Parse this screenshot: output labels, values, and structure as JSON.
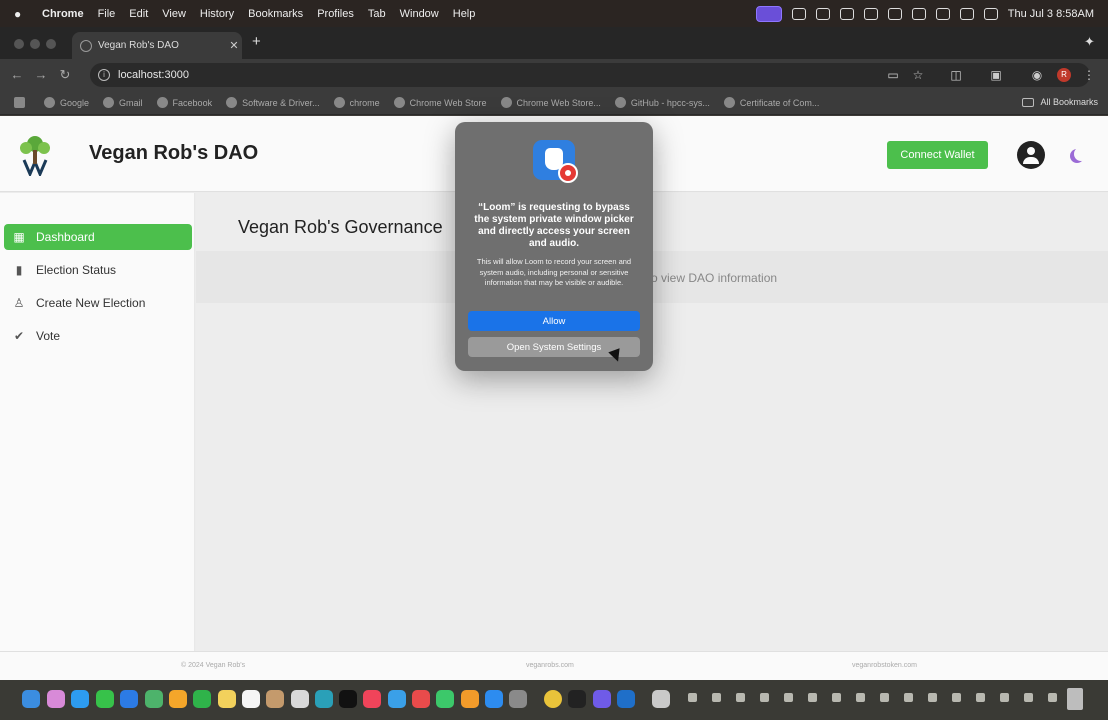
{
  "menubar": {
    "app": "Chrome",
    "items": [
      "File",
      "Edit",
      "View",
      "History",
      "Bookmarks",
      "Profiles",
      "Tab",
      "Window",
      "Help"
    ],
    "clock": "Thu Jul 3  8:58AM",
    "status_icons": [
      "screen-record-icon",
      "loom-icon",
      "network-icon",
      "grid-icon",
      "cloud-icon",
      "play-icon",
      "battery-icon",
      "wifi-icon",
      "search-icon",
      "control-center-icon"
    ]
  },
  "browser": {
    "tab_title": "Vegan Rob's DAO",
    "url": "localhost:3000",
    "bookmarks": [
      "Google",
      "Gmail",
      "Facebook",
      "Software & Driver...",
      "chrome",
      "Chrome Web Store",
      "Chrome Web Store...",
      "GitHub - hpcc-sys...",
      "Certificate of Com..."
    ],
    "all_bookmarks": "All Bookmarks",
    "profile_initial": "R"
  },
  "site": {
    "title": "Vegan Rob's DAO",
    "connect_wallet": "Connect Wallet",
    "nav": [
      {
        "label": "Dashboard",
        "icon": "dashboard-icon",
        "active": true
      },
      {
        "label": "Election Status",
        "icon": "bar-chart-icon",
        "active": false
      },
      {
        "label": "Create New Election",
        "icon": "stamp-icon",
        "active": false
      },
      {
        "label": "Vote",
        "icon": "vote-icon",
        "active": false
      }
    ],
    "governance_title": "Vegan Rob's Governance",
    "connect_message": "t to view DAO information",
    "footer": {
      "copyright": "© 2024 Vegan Rob's",
      "site1": "veganrobs.com",
      "site2": "veganrobstoken.com"
    }
  },
  "dialog": {
    "title": "“Loom” is requesting to bypass the system private window picker and directly access your screen and audio.",
    "body": "This will allow Loom to record your screen and system audio, including personal or sensitive information that may be visible or audible.",
    "allow": "Allow",
    "open_settings": "Open System Settings"
  },
  "colors": {
    "accent_green": "#4cbf4c",
    "dialog_blue": "#1a73e8",
    "moon_purple": "#9b6bd6"
  }
}
